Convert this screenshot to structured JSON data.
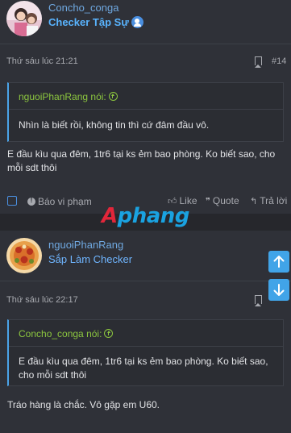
{
  "posts": [
    {
      "username": "Concho_conga",
      "user_title": "Checker Tập Sự",
      "timestamp": "Thứ sáu lúc 21:21",
      "post_number": "#14",
      "quote": {
        "author_line": "nguoiPhanRang nói:",
        "text": "Nhìn là biết rồi, không tin thì cứ đâm đầu vô."
      },
      "message": "E đầu kìu qua đêm, 1tr6 tại ks ẻm bao phòng. Ko biết sao, cho mỗi sdt thôi"
    },
    {
      "username": "nguoiPhanRang",
      "user_title": "Sắp Làm Checker",
      "timestamp": "Thứ sáu lúc 22:17",
      "quote": {
        "author_line": "Concho_conga nói:",
        "text": "E đầu kìu qua đêm, 1tr6 tại ks ẻm bao phòng. Ko biết sao, cho mỗi sdt thôi"
      },
      "message": "Tráo hàng là chắc. Vô gặp em U60."
    }
  ],
  "actions": {
    "report": "Báo vi phạm",
    "like": "Like",
    "quote": "Quote",
    "reply": "Trả lời"
  },
  "watermark": {
    "first": "A",
    "rest": "phang"
  },
  "icons": {
    "verified": "user-check-icon",
    "bookmark": "bookmark-icon",
    "quote_jump": "arrow-up-circle-icon",
    "like": "thumbs-up-icon",
    "quote": "quote-icon",
    "reply": "reply-icon",
    "scroll_up": "arrow-up-icon",
    "scroll_down": "arrow-down-icon"
  },
  "colors": {
    "background": "#2a2c33",
    "link": "#6fa8e0",
    "quote_author": "#8cc63f",
    "accent": "#41a4e8"
  }
}
